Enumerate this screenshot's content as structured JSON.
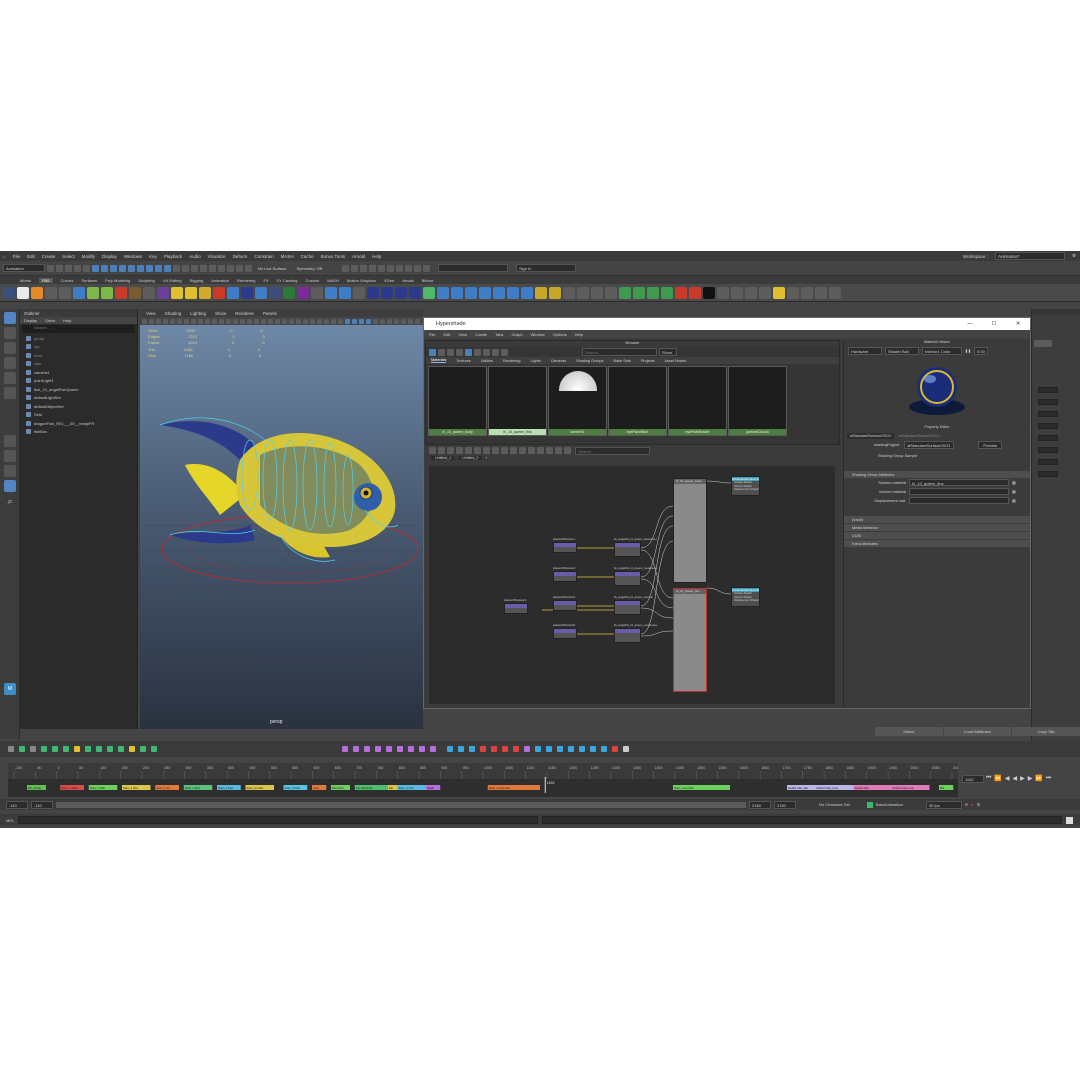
{
  "menubar": [
    "File",
    "Edit",
    "Create",
    "Select",
    "Modify",
    "Display",
    "Windows",
    "Key",
    "Playback",
    "Audio",
    "Visualize",
    "Deform",
    "Constrain",
    "MASH",
    "Cache",
    "Bonus Tools",
    "Arnold",
    "Help"
  ],
  "workspace": {
    "label": "Workspace :",
    "value": "Animation*"
  },
  "status": {
    "mode": "Animation",
    "live": "No Live Surface",
    "symmetry": "Symmetry: Off",
    "signin": "Sign In"
  },
  "shelf_tabs": [
    "Moms",
    "FBS",
    "Curves",
    "Surfaces",
    "Poly Modeling",
    "Sculpting",
    "UV Editing",
    "Rigging",
    "Animation",
    "Rendering",
    "FX",
    "FX Caching",
    "Custom",
    "MASH",
    "Motion Graphics",
    "XGen",
    "Arnold",
    "Bifrost"
  ],
  "shelf_active": "FBS",
  "outliner": {
    "title": "Outliner",
    "menus": [
      "Display",
      "Show",
      "Help"
    ],
    "search": "Search...",
    "items": [
      "persp",
      "top",
      "front",
      "side",
      "camera1",
      "pointLight1",
      "fish_10_angelFishQueen",
      "defaultLightSet",
      "defaultObjectSet",
      "Sets",
      "dragonFish_RIG___05__readyFR",
      "fishBox"
    ]
  },
  "viewport": {
    "menus": [
      "View",
      "Shading",
      "Lighting",
      "Show",
      "Renderer",
      "Panels"
    ],
    "hud": [
      {
        "k": "Verts:",
        "a": "1090",
        "b": "0",
        "c": "0"
      },
      {
        "k": "Edges:",
        "a": "2211",
        "b": "0",
        "c": "0"
      },
      {
        "k": "Faces:",
        "a": "1014",
        "b": "0",
        "c": "0"
      },
      {
        "k": "Tris:",
        "a": "2186",
        "b": "0",
        "c": "0"
      },
      {
        "k": "UVs:",
        "a": "1180",
        "b": "0",
        "c": "0"
      }
    ],
    "camera": "persp"
  },
  "hypershade": {
    "title": "Hypershade",
    "menus": [
      "File",
      "Edit",
      "View",
      "Create",
      "Tabs",
      "Graph",
      "Window",
      "Options",
      "Help"
    ],
    "browser_title": "Browser",
    "search": "Search...",
    "show": "Show",
    "tabs": [
      "Materials",
      "Textures",
      "Utilities",
      "Rendering",
      "Lights",
      "Cameras",
      "Shading Groups",
      "Bake Sets",
      "Projects",
      "Asset Nodes"
    ],
    "swatches": [
      "hl_10_queen_body",
      "hl_10_queen_fins",
      "lambert1",
      "eyeFisheBlue",
      "eyeFishShader",
      "particleCloud1"
    ],
    "swatch_selected": 1,
    "graph_tabs": [
      "Untitled_1",
      "Untitled_2"
    ],
    "node_search": "Search...",
    "nodes": {
      "place1": "place2dTexture1",
      "place2": "place2dTexture2",
      "place3": "place2dTexture3",
      "place4": "place2dTexture4",
      "place5": "place2dTexture5",
      "file1": "fis_angelFis_IA_queen_baseColor",
      "file2": "fis_angelFis_IA_queen_metalness",
      "file3": "fis_angelFis_IA_queen_normal",
      "file4": "fis_angelFis_IA_queen_roughness",
      "bump": "bump2d1",
      "mat1": "hl_10_queen_body",
      "mat2": "hl_10_queen_fins",
      "sg1": "aiStandardSurface1SG",
      "sg2": "aiStandardSurface2SG"
    },
    "sg_ports": [
      "Surface Shader",
      "Volume Shader",
      "Displacement Shader"
    ]
  },
  "material_viewer": {
    "title": "Material Viewer",
    "renderer": "Hardware",
    "shape": "Shader Ball",
    "env": "Interior1 Color",
    "value": "0.00"
  },
  "property_editor": {
    "title": "Property Editor",
    "tab1": "aiStandardSurface2SG1",
    "tab2": "aiStandardSurface2SG1",
    "engine_label": "shadingEngine:",
    "engine_value": "aiStandardSurface2SG1",
    "presets": "Presets",
    "sample": "Shading Group Sample",
    "section_main": "Shading Group Attributes",
    "fields": [
      {
        "label": "Surface material",
        "value": "hl_10_queen_fins"
      },
      {
        "label": "Volume material",
        "value": ""
      },
      {
        "label": "Displacement mat.",
        "value": ""
      }
    ],
    "sections": [
      "Arnold",
      "Media Behavior",
      "UUID",
      "Extra Attributes"
    ]
  },
  "attribute_buttons": [
    "Select",
    "Load Attributes",
    "Copy Tab"
  ],
  "timeline": {
    "ticks": [
      "-100",
      "-50",
      "0",
      "50",
      "100",
      "150",
      "200",
      "250",
      "300",
      "350",
      "400",
      "450",
      "500",
      "550",
      "600",
      "650",
      "700",
      "750",
      "800",
      "850",
      "900",
      "950",
      "1000",
      "1050",
      "1100",
      "1150",
      "1200",
      "1250",
      "1300",
      "1350",
      "1400",
      "1450",
      "1500",
      "1550",
      "1600",
      "1650",
      "1700",
      "1750",
      "1800",
      "1850",
      "1900",
      "1950",
      "2000",
      "2050",
      "2100"
    ],
    "current": "1162",
    "clips": [
      {
        "label": "fish_1 drag",
        "color": "#5fbf4f",
        "s": 0.02,
        "e": 0.04
      },
      {
        "label": "Swim_1 Catch",
        "color": "#d94c4c",
        "s": 0.055,
        "e": 0.08
      },
      {
        "label": "Swim_1 Path",
        "color": "#6dcf5d",
        "s": 0.085,
        "e": 0.115
      },
      {
        "label": "Swim_1 Dive",
        "color": "#d8c64e",
        "s": 0.12,
        "e": 0.15
      },
      {
        "label": "Swim_1 Up",
        "color": "#e07a3c",
        "s": 0.155,
        "e": 0.18
      },
      {
        "label": "Swim_2 Dive",
        "color": "#5bc27e",
        "s": 0.185,
        "e": 0.215
      },
      {
        "label": "Swim_2 Fast",
        "color": "#59b9e0",
        "s": 0.22,
        "e": 0.245
      },
      {
        "label": "Swim_3 Catch",
        "color": "#d8c64e",
        "s": 0.25,
        "e": 0.28
      },
      {
        "label": "Swim_3 Path",
        "color": "#5bc2e0",
        "s": 0.29,
        "e": 0.315
      },
      {
        "label": "Loop",
        "color": "#e07a3c",
        "s": 0.32,
        "e": 0.335
      },
      {
        "label": "Dart Swim",
        "color": "#6dcf5d",
        "s": 0.34,
        "e": 0.36
      },
      {
        "label": "Turn Dive/pole",
        "color": "#4fbf6f",
        "s": 0.365,
        "e": 0.4
      },
      {
        "label": "Eat",
        "color": "#d8c64e",
        "s": 0.4,
        "e": 0.41
      },
      {
        "label": "Swim_3 Turn",
        "color": "#59b9e0",
        "s": 0.41,
        "e": 0.44
      },
      {
        "label": "Death",
        "color": "#b86ed8",
        "s": 0.44,
        "e": 0.455
      },
      {
        "label": "Swim_4 Loop Fast",
        "color": "#e07a3c",
        "s": 0.505,
        "e": 0.56
      },
      {
        "label": "Swim_Loop Fast",
        "color": "#6dcf5d",
        "s": 0.7,
        "e": 0.76
      },
      {
        "label": "Death1 Side_Idle",
        "color": "#b8b6e8",
        "s": 0.82,
        "e": 0.85
      },
      {
        "label": "Death1 Side_Loop",
        "color": "#b8b6e8",
        "s": 0.85,
        "e": 0.89
      },
      {
        "label": "Death2 Side",
        "color": "#e07ab8",
        "s": 0.89,
        "e": 0.93
      },
      {
        "label": "Death2 Float Loop",
        "color": "#e07ab8",
        "s": 0.93,
        "e": 0.97
      },
      {
        "label": "Idle",
        "color": "#6dcf5d",
        "s": 0.98,
        "e": 0.995
      }
    ]
  },
  "range": {
    "start": "-110",
    "inner_start": "-110",
    "inner_end": "2160",
    "end": "2160",
    "character": "No Character Set",
    "anim_layer": "BaseAnimation",
    "fps": "30 fps",
    "frame_box": "1162"
  },
  "cmd": {
    "label": "MEL"
  }
}
